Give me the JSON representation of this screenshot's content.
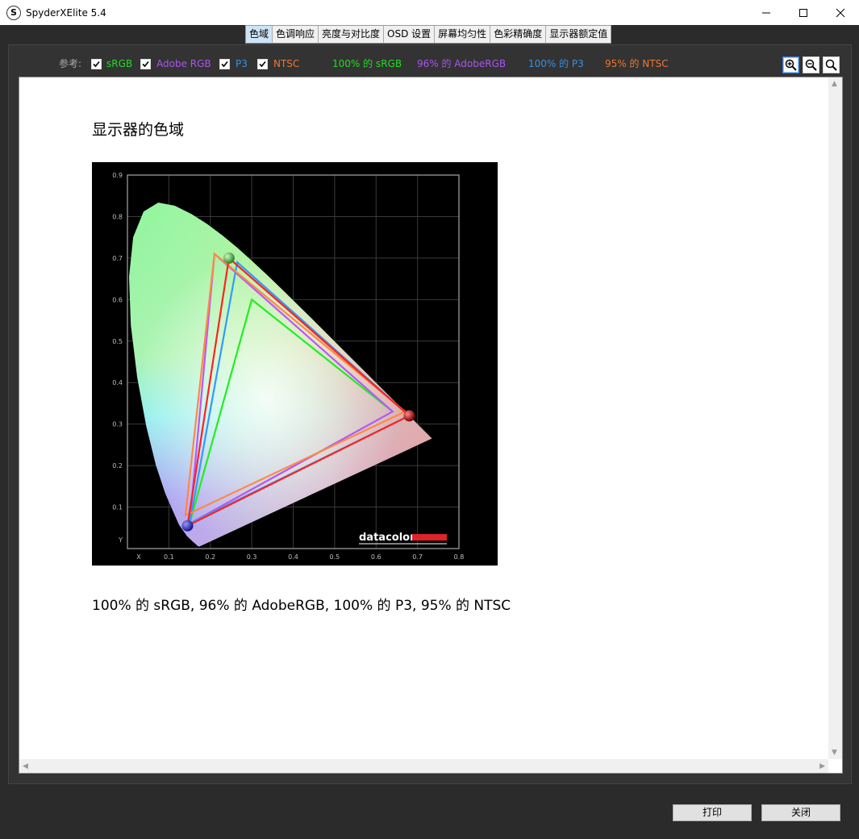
{
  "window": {
    "title": "SpyderXElite 5.4",
    "icon_letter": "S"
  },
  "tabs": [
    {
      "label": "色域",
      "active": true
    },
    {
      "label": "色调响应"
    },
    {
      "label": "亮度与对比度"
    },
    {
      "label": "OSD 设置"
    },
    {
      "label": "屏幕均匀性"
    },
    {
      "label": "色彩精确度"
    },
    {
      "label": "显示器额定值"
    }
  ],
  "legend": {
    "prefix": "参考:",
    "items": [
      {
        "label": "sRGB",
        "checked": true,
        "color": "#22dd22"
      },
      {
        "label": "Adobe RGB",
        "checked": true,
        "color": "#aa55ee"
      },
      {
        "label": "P3",
        "checked": true,
        "color": "#3a8fe0"
      },
      {
        "label": "NTSC",
        "checked": true,
        "color": "#ee7733"
      }
    ],
    "results": [
      {
        "text": "100% 的 sRGB",
        "color": "#22dd22"
      },
      {
        "text": "96% 的 AdobeRGB",
        "color": "#aa55ee"
      },
      {
        "text": "100% 的 P3",
        "color": "#3a8fe0"
      },
      {
        "text": "95% 的 NTSC",
        "color": "#ee7733"
      }
    ]
  },
  "report": {
    "title": "显示器的色域",
    "summary": "100% 的 sRGB, 96% 的 AdobeRGB, 100% 的 P3, 95% 的 NTSC"
  },
  "chart": {
    "brand": "datacolor",
    "x_axis_label": "X",
    "y_axis_label": "Y",
    "x_ticks": [
      "0.1",
      "0.2",
      "0.3",
      "0.4",
      "0.5",
      "0.6",
      "0.7",
      "0.8"
    ],
    "y_ticks": [
      "0.1",
      "0.2",
      "0.3",
      "0.4",
      "0.5",
      "0.6",
      "0.7",
      "0.8",
      "0.9"
    ]
  },
  "chart_data": {
    "type": "scatter",
    "xlim": [
      0,
      0.8
    ],
    "ylim": [
      0,
      0.9
    ],
    "series": [
      {
        "name": "sRGB",
        "color": "#22ee22",
        "points": [
          [
            0.64,
            0.33
          ],
          [
            0.3,
            0.6
          ],
          [
            0.15,
            0.06
          ]
        ]
      },
      {
        "name": "Adobe RGB",
        "color": "#bb55ff",
        "points": [
          [
            0.64,
            0.33
          ],
          [
            0.21,
            0.71
          ],
          [
            0.15,
            0.06
          ]
        ]
      },
      {
        "name": "P3",
        "color": "#3399ff",
        "points": [
          [
            0.68,
            0.32
          ],
          [
            0.265,
            0.69
          ],
          [
            0.15,
            0.06
          ]
        ]
      },
      {
        "name": "NTSC",
        "color": "#ff8844",
        "points": [
          [
            0.67,
            0.33
          ],
          [
            0.21,
            0.71
          ],
          [
            0.14,
            0.08
          ]
        ]
      },
      {
        "color": "#ff2222",
        "points": [
          [
            0.68,
            0.32
          ],
          [
            0.245,
            0.7
          ],
          [
            0.145,
            0.055
          ]
        ]
      }
    ]
  },
  "footer": {
    "print_label": "打印",
    "close_label": "关闭"
  }
}
